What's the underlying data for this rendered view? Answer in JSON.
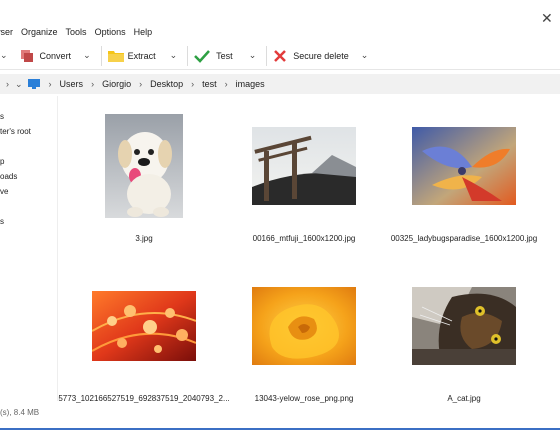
{
  "window": {
    "close_glyph": "✕"
  },
  "menu": [
    "wser",
    "Organize",
    "Tools",
    "Options",
    "Help"
  ],
  "toolbar": {
    "convert": "Convert",
    "extract": "Extract",
    "test": "Test",
    "secure_delete": "Secure delete"
  },
  "address": {
    "segments": [
      "Users",
      "Giorgio",
      "Desktop",
      "test",
      "images"
    ]
  },
  "sidebar": {
    "items": [
      "s",
      "ter's root",
      "p",
      "oads",
      "ve",
      "s"
    ]
  },
  "files": [
    {
      "name": "3.jpg",
      "thumb": "puppy"
    },
    {
      "name": "00166_mtfuji_1600x1200.jpg",
      "thumb": "torii"
    },
    {
      "name": "00325_ladybugsparadise_1600x1200.jpg",
      "thumb": "flower"
    },
    {
      "name": "5773_102166527519_692837519_2040793_2...",
      "thumb": "drops"
    },
    {
      "name": "13043-yelow_rose_png.png",
      "thumb": "rose"
    },
    {
      "name": "A_cat.jpg",
      "thumb": "cat"
    }
  ],
  "status": {
    "text": "(s), 8.4 MB"
  },
  "colors": {
    "accent": "#3b6fc4",
    "check": "#2ea043",
    "delete": "#e23b3b",
    "folder": "#f5c518"
  }
}
